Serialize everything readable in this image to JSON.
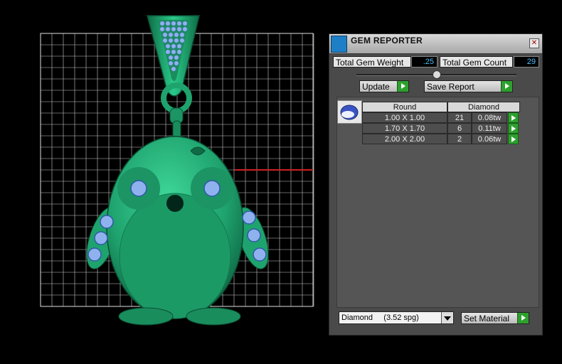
{
  "viewport": {
    "model_name": "penguin-pendant",
    "gem_color": "#8fb1ee",
    "metal_color": "#1fa36e",
    "grid_color": "#d0d0d0"
  },
  "panel": {
    "title": "GEM REPORTER",
    "close_glyph": "✕",
    "total_weight_label": "Total Gem Weight",
    "total_weight_value": ".25",
    "total_count_label": "Total Gem Count",
    "total_count_value": "29",
    "update_label": "Update",
    "save_report_label": "Save Report",
    "table": {
      "headers": [
        "Round",
        "Diamond"
      ],
      "rows": [
        {
          "size": "1.00 X 1.00",
          "count": "21",
          "weight": "0.08tw"
        },
        {
          "size": "1.70 X 1.70",
          "count": "6",
          "weight": "0.11tw"
        },
        {
          "size": "2.00 X 2.00",
          "count": "2",
          "weight": "0.06tw"
        }
      ]
    },
    "material_select": "Diamond     (3.52 spg)",
    "set_material_label": "Set Material"
  }
}
